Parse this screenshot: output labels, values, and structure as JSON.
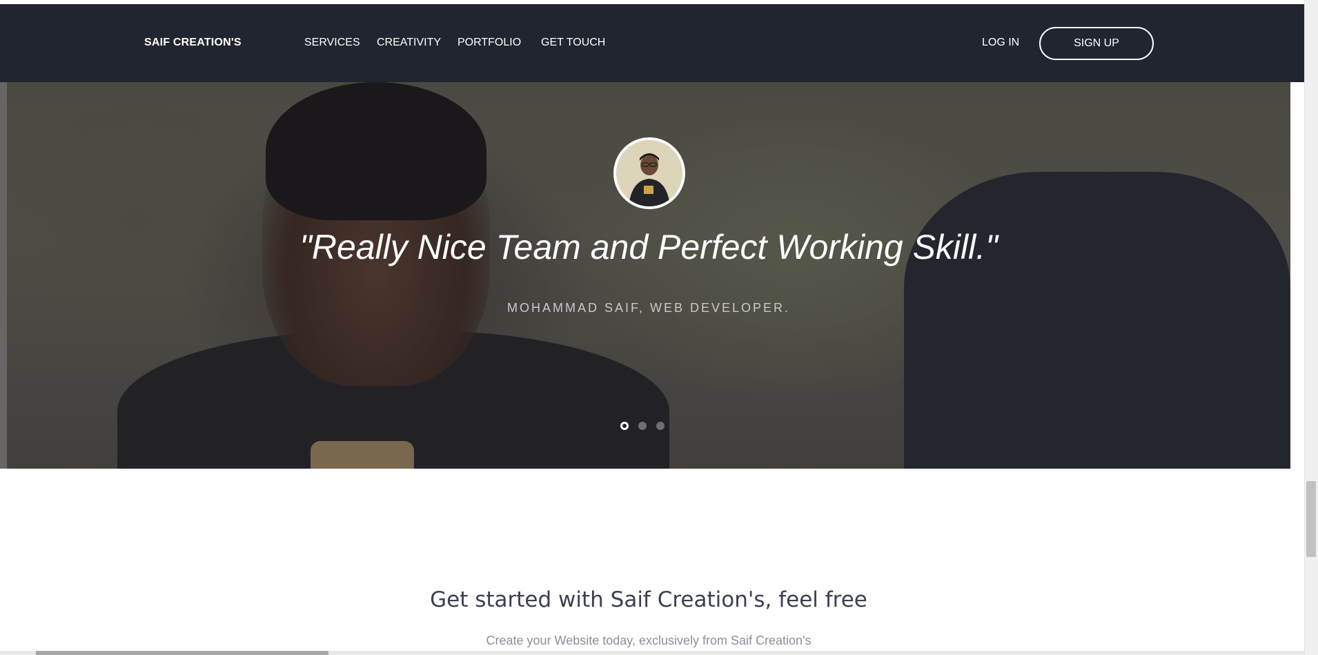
{
  "navbar": {
    "brand": "SAIF CREATION'S",
    "links": [
      "SERVICES",
      "CREATIVITY",
      "PORTFOLIO",
      "GET TOUCH"
    ],
    "login_label": "LOG IN",
    "signup_label": "SIGN UP"
  },
  "hero": {
    "quote": "\"Really Nice Team and Perfect Working Skill.\"",
    "author": "MOHAMMAD SAIF, WEB DEVELOPER.",
    "slides": {
      "count": 3,
      "active_index": 0
    }
  },
  "cta": {
    "title": "Get started with Saif Creation's, feel free",
    "subtitle": "Create your Website today, exclusively from Saif Creation's"
  },
  "colors": {
    "navbar_bg": "#212530",
    "text_dark": "#3c4050",
    "text_muted": "#8a8f9c"
  }
}
